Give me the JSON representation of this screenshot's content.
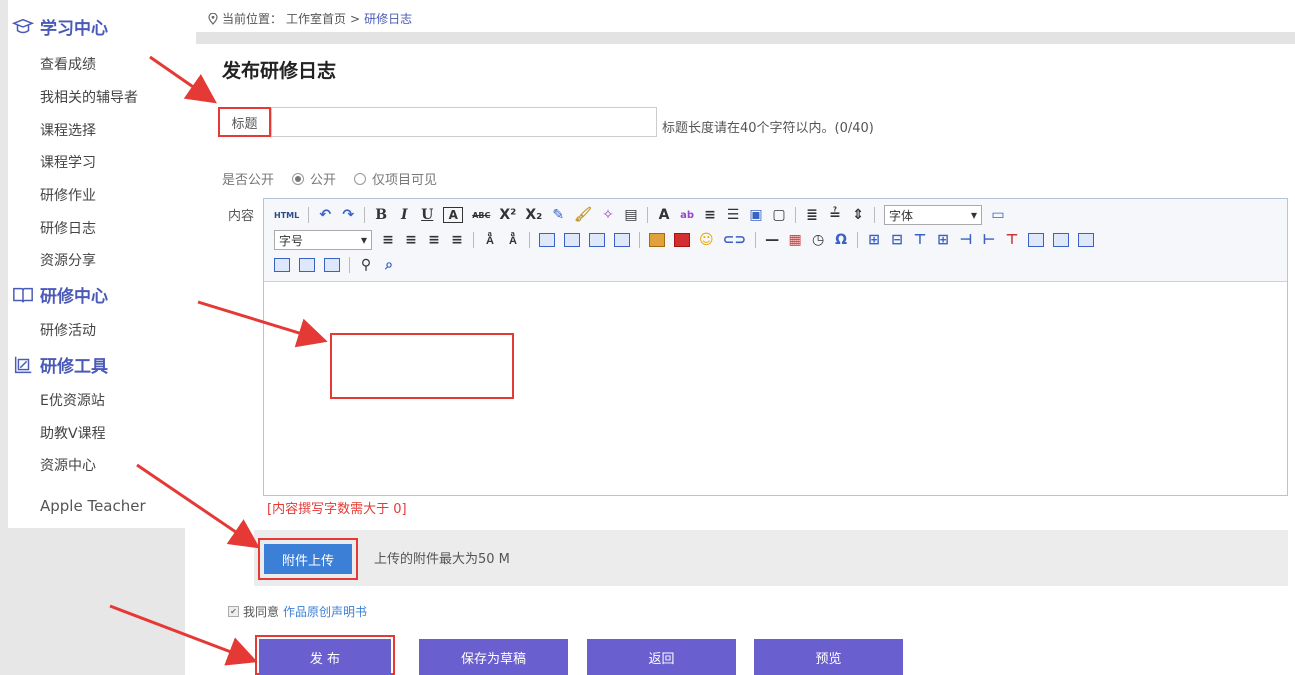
{
  "sidebar": {
    "sections": [
      {
        "title": "学习中心",
        "icon": "graduation-cap-icon",
        "items": [
          "查看成绩",
          "我相关的辅导者",
          "课程选择",
          "课程学习",
          "研修作业",
          "研修日志",
          "资源分享"
        ]
      },
      {
        "title": "研修中心",
        "icon": "book-icon",
        "items": [
          "研修活动"
        ]
      },
      {
        "title": "研修工具",
        "icon": "tools-icon",
        "items": [
          "E优资源站",
          "助教V课程",
          "资源中心",
          "Apple Teacher"
        ]
      }
    ]
  },
  "breadcrumb": {
    "label": "当前位置：",
    "home": "工作室首页",
    "separator": ">",
    "current": "研修日志"
  },
  "page": {
    "title": "发布研修日志"
  },
  "form": {
    "title_label": "标题",
    "title_value": "",
    "title_hint": "标题长度请在40个字符以内。(0/40)",
    "public_label": "是否公开",
    "public_options": [
      "公开",
      "仅项目可见"
    ],
    "public_selected": "公开",
    "content_label": "内容",
    "font_select": "字体",
    "size_select": "字号",
    "word_count_hint": "[内容撰写字数需大于 0]",
    "attach_button": "附件上传",
    "attach_hint": "上传的附件最大为50 M",
    "agree_text": "我同意",
    "agree_link": "作品原创声明书"
  },
  "toolbar": {
    "row1": [
      "HTML",
      "B",
      "I",
      "U",
      "A",
      "ABC",
      "X²",
      "X₂",
      "A",
      "ab"
    ],
    "colors": {
      "accent": "#6a5fcf",
      "link": "#3b7fd6",
      "annotation": "#e53935",
      "sidebar_title": "#4a5ab7"
    }
  },
  "actions": {
    "publish": "发 布",
    "save_draft": "保存为草稿",
    "back": "返回",
    "preview": "预览"
  }
}
